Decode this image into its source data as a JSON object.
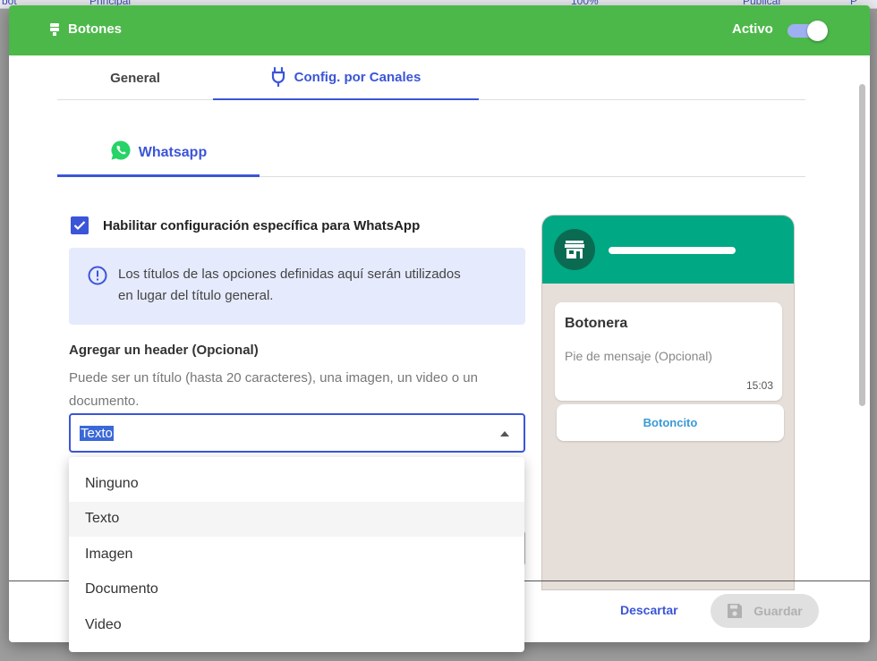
{
  "background": {
    "toolbar_items": [
      "bot",
      "Principal",
      "100%",
      "Publicar",
      "P"
    ]
  },
  "header": {
    "title": "Botones",
    "active_label": "Activo",
    "active_on": true
  },
  "tabs": [
    {
      "label": "General",
      "active": false
    },
    {
      "label": "Config. por Canales",
      "active": true,
      "icon": "plug-icon"
    }
  ],
  "subtabs": [
    {
      "label": "Whatsapp",
      "icon": "whatsapp-icon",
      "active": true
    }
  ],
  "form": {
    "enable_label": "Habilitar configuración específica para WhatsApp",
    "enable_checked": true,
    "info_text": "Los títulos de las opciones definidas aquí serán utilizados en lugar del título general.",
    "header_title": "Agregar un header (Opcional)",
    "header_desc": "Puede ser un título (hasta 20 caracteres), una imagen, un video o un documento.",
    "header_select_value": "Texto"
  },
  "dropdown": {
    "options": [
      "Ninguno",
      "Texto",
      "Imagen",
      "Documento",
      "Video"
    ],
    "highlighted": "Texto"
  },
  "preview": {
    "message_title": "Botonera",
    "footer_placeholder": "Pie de mensaje (Opcional)",
    "time": "15:03",
    "button_label": "Botoncito"
  },
  "footer": {
    "discard_label": "Descartar",
    "save_label": "Guardar"
  },
  "colors": {
    "header_green": "#4cb84a",
    "accent_blue": "#3b55d8",
    "whatsapp_green": "#00a884"
  }
}
